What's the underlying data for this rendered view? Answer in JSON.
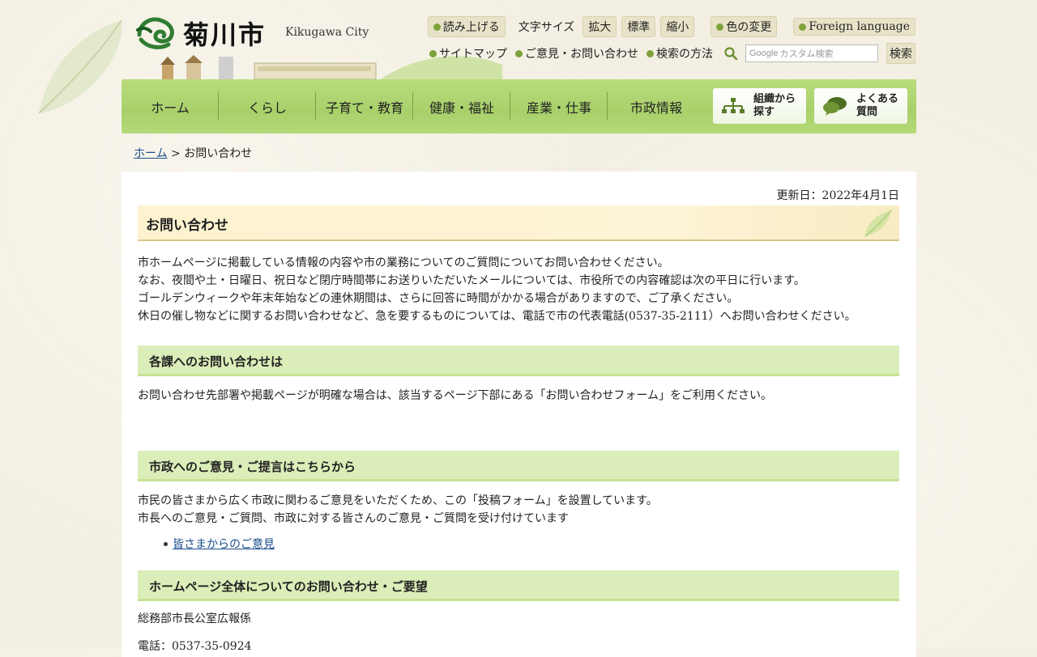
{
  "header": {
    "logo_text": "菊川市",
    "logo_en": "Kikugawa City",
    "toolbar": {
      "read_aloud": "読み上げる",
      "font_size_label": "文字サイズ",
      "font_large": "拡大",
      "font_normal": "標準",
      "font_small": "縮小",
      "color_change": "色の変更",
      "foreign_language": "Foreign language"
    },
    "links": {
      "sitemap": "サイトマップ",
      "feedback": "ご意見・お問い合わせ",
      "search_method": "検索の方法"
    },
    "search": {
      "placeholder": "カスタム検索",
      "google_label": "Google",
      "button": "検索"
    }
  },
  "nav": {
    "items": [
      "ホーム",
      "くらし",
      "子育て・教育",
      "健康・福祉",
      "産業・仕事",
      "市政情報"
    ],
    "org_search": [
      "組織から",
      "探す"
    ],
    "faq": [
      "よくある",
      "質問"
    ]
  },
  "breadcrumb": {
    "home": "ホーム",
    "separator": ">",
    "current": "お問い合わせ"
  },
  "main": {
    "updated": "更新日：2022年4月1日",
    "title": "お問い合わせ",
    "intro": [
      "市ホームページに掲載している情報の内容や市の業務についてのご質問についてお問い合わせください。",
      "なお、夜間や土・日曜日、祝日など閉庁時間帯にお送りいただいたメールについては、市役所での内容確認は次の平日に行います。",
      "ゴールデンウィークや年末年始などの連休期間は、さらに回答に時間がかかる場合がありますので、ご了承ください。",
      "休日の催し物などに関するお問い合わせなど、急を要するものについては、電話で市の代表電話(0537-35-2111）へお問い合わせください。"
    ],
    "section1_title": "各課へのお問い合わせは",
    "section1_text": "お問い合わせ先部署や掲載ページが明確な場合は、該当するページ下部にある「お問い合わせフォーム」をご利用ください。",
    "section2_title": "市政へのご意見・ご提言はこちらから",
    "section2_text": [
      "市民の皆さまから広く市政に関わるご意見をいただくため、この「投稿フォーム」を設置しています。",
      "市長へのご意見・ご質問、市政に対する皆さんのご意見・ご質問を受け付けています"
    ],
    "section2_link": "皆さまからのご意見",
    "section3_title": "ホームページ全体についてのお問い合わせ・ご要望",
    "section3_dept": "総務部市長公室広報係",
    "section3_phone": "電話：0537-35-0924"
  }
}
